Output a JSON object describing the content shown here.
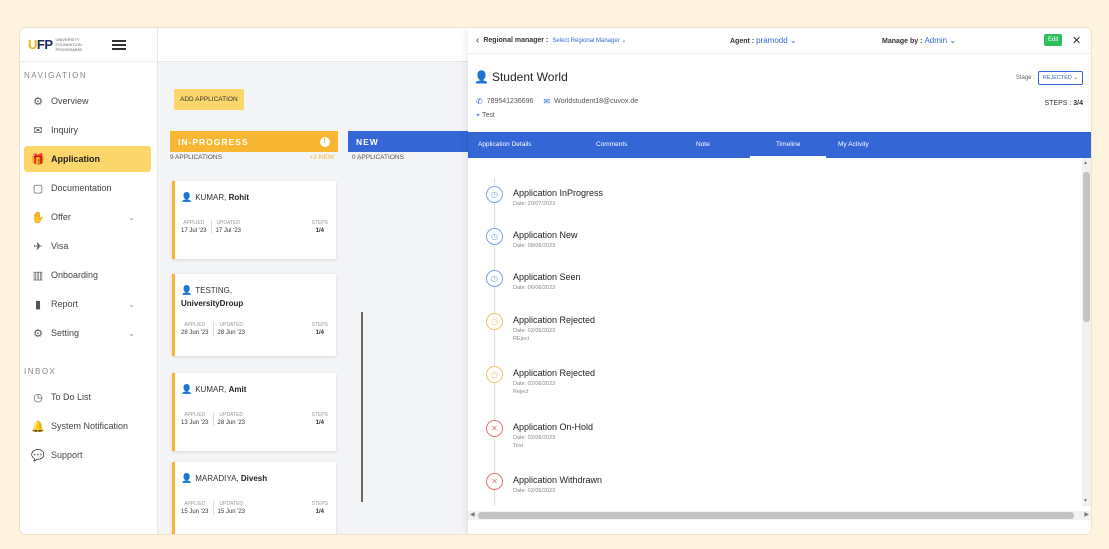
{
  "logo": {
    "mark": "UFP",
    "sub": "UNIVERSITY FOUNDATION PROGRAMME"
  },
  "sidebar": {
    "nav_heading": "NAVIGATION",
    "items": [
      {
        "label": "Overview",
        "icon": "gear-icon"
      },
      {
        "label": "Inquiry",
        "icon": "mail-icon"
      },
      {
        "label": "Application",
        "icon": "gift-icon",
        "active": true
      },
      {
        "label": "Documentation",
        "icon": "document-icon"
      },
      {
        "label": "Offer",
        "icon": "hand-icon",
        "chevron": true
      },
      {
        "label": "Visa",
        "icon": "plane-icon"
      },
      {
        "label": "Onboarding",
        "icon": "building-icon"
      },
      {
        "label": "Report",
        "icon": "bar-chart-icon",
        "chevron": true
      },
      {
        "label": "Setting",
        "icon": "settings-icon",
        "chevron": true
      }
    ],
    "inbox_heading": "INBOX",
    "inbox_items": [
      {
        "label": "To Do List",
        "icon": "clock-icon"
      },
      {
        "label": "System Notification",
        "icon": "bell-icon"
      },
      {
        "label": "Support",
        "icon": "chat-icon"
      }
    ]
  },
  "board": {
    "add_button": "ADD APPLICATION",
    "columns": {
      "inprogress": {
        "title": "IN-PROGRESS",
        "count": "9 APPLICATIONS",
        "new_count": "+2 NEW"
      },
      "new": {
        "title": "NEW",
        "count": "0 APPLICATIONS"
      }
    },
    "cards": [
      {
        "surname": "KUMAR,",
        "first": "Rohit",
        "applied": "17 Jul '23",
        "updated": "17 Jul '23",
        "steps": "1/4"
      },
      {
        "surname": "TESTING,",
        "first": "UniversityDroup",
        "applied": "28 Jun '23",
        "updated": "28 Jun '23",
        "steps": "1/4"
      },
      {
        "surname": "KUMAR,",
        "first": "Amit",
        "applied": "13 Jun '23",
        "updated": "28 Jun '23",
        "steps": "1/4"
      },
      {
        "surname": "MARADIYA,",
        "first": "Divesh",
        "applied": "15 Jun '23",
        "updated": "15 Jun '23",
        "steps": "1/4"
      }
    ],
    "labels": {
      "applied": "APPLIED",
      "updated": "UPDATED",
      "steps": "STEPS"
    }
  },
  "panel": {
    "regional_label": "Regional manager :",
    "regional_select": "Select Regional Manager ⌄",
    "agent_label": "Agent :",
    "agent_value": "pramodd ⌄",
    "manage_label": "Manage by :",
    "manage_value": "Admin ⌄",
    "edit": "Edit",
    "title": "Student World",
    "stage_label": "Stage :",
    "stage_value": "REJECTED ⌄",
    "phone": "789541236696",
    "email": "Worldstudent18@cuvox.de",
    "location": "Test",
    "steps_label": "STEPS :",
    "steps_value": "3/4",
    "tabs": [
      "Application Details",
      "Comments",
      "Note",
      "Timeline",
      "My Activity"
    ],
    "active_tab": "Timeline",
    "timeline": [
      {
        "title": "Application InProgress",
        "date": "Date: 20/07/2023",
        "note": "",
        "kind": "info"
      },
      {
        "title": "Application New",
        "date": "Date: 08/06/2023",
        "note": "",
        "kind": "info"
      },
      {
        "title": "Application Seen",
        "date": "Date: 06/06/2023",
        "note": "",
        "kind": "info"
      },
      {
        "title": "Application Rejected",
        "date": "Date: 02/06/2023",
        "note": "REject",
        "kind": "warn"
      },
      {
        "title": "Application Rejected",
        "date": "Date: 02/06/2023",
        "note": "Reject",
        "kind": "warn"
      },
      {
        "title": "Application On-Hold",
        "date": "Date: 02/06/2023",
        "note": "Test",
        "kind": "err"
      },
      {
        "title": "Application Withdrawn",
        "date": "Date: 02/06/2023",
        "note": "",
        "kind": "err"
      }
    ]
  },
  "colors": {
    "accent_yellow": "#f7b733",
    "accent_blue": "#3566d6",
    "edit_green": "#2fbf5b"
  }
}
